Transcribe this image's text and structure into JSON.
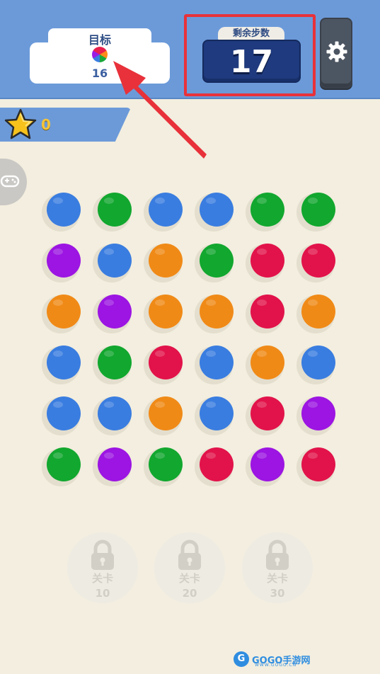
{
  "goal": {
    "title": "目标",
    "target_icon": "multicolor-ball-icon",
    "count": "16"
  },
  "moves": {
    "label": "剩余步数",
    "value": "17"
  },
  "settings": {
    "icon": "gear-icon"
  },
  "stars": {
    "icon": "star-icon",
    "count": "0"
  },
  "side_tab": {
    "icon": "gamepad-icon"
  },
  "colors": {
    "blue": "#3a7de0",
    "green": "#12a72f",
    "purple": "#9c15e2",
    "orange": "#f08a17",
    "red": "#e2134a"
  },
  "board": {
    "rows": [
      [
        "blue",
        "green",
        "blue",
        "blue",
        "green",
        "green"
      ],
      [
        "purple",
        "blue",
        "orange",
        "green",
        "red",
        "red"
      ],
      [
        "orange",
        "purple",
        "orange",
        "orange",
        "red",
        "orange"
      ],
      [
        "blue",
        "green",
        "red",
        "blue",
        "orange",
        "blue"
      ],
      [
        "blue",
        "blue",
        "orange",
        "blue",
        "red",
        "purple"
      ],
      [
        "green",
        "purple",
        "green",
        "red",
        "purple",
        "red"
      ]
    ]
  },
  "locked_levels": [
    {
      "label": "关卡",
      "number": "10",
      "icon": "lock-icon"
    },
    {
      "label": "关卡",
      "number": "20",
      "icon": "lock-icon"
    },
    {
      "label": "关卡",
      "number": "30",
      "icon": "lock-icon"
    }
  ],
  "watermark": {
    "logo": "G",
    "brand": "GOGO手游网",
    "url": "WWW.GOGO.CN"
  }
}
